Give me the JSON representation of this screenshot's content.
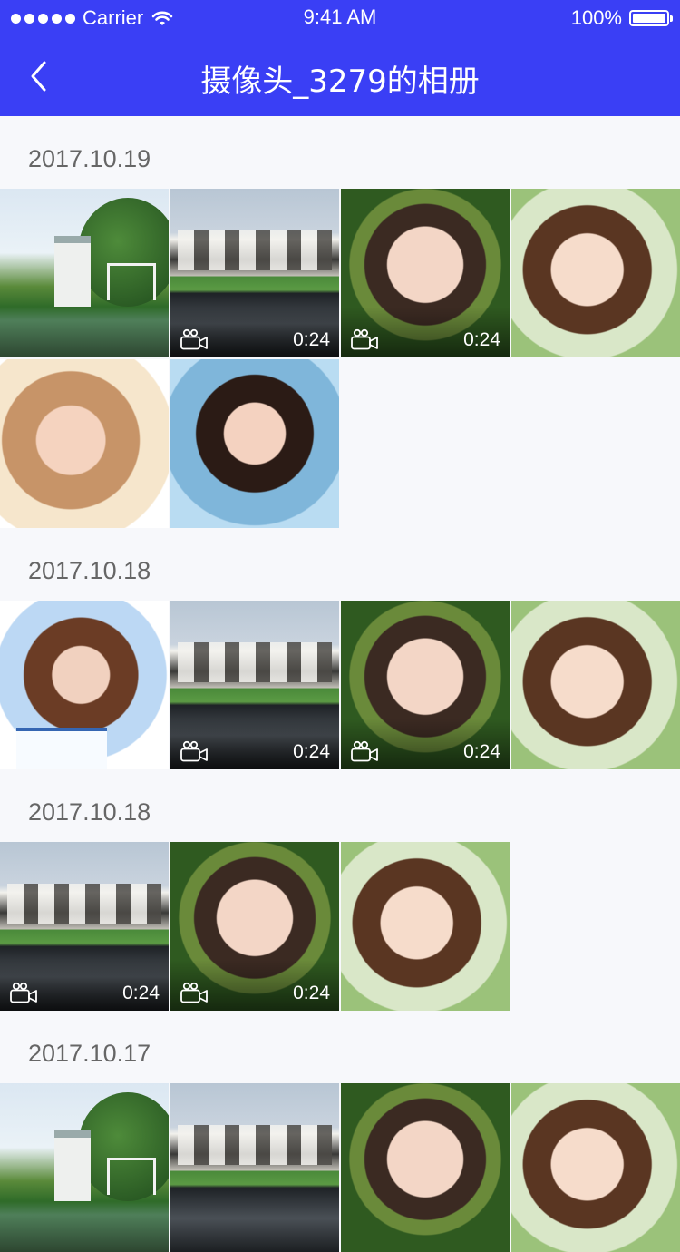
{
  "status_bar": {
    "carrier": "Carrier",
    "time": "9:41 AM",
    "battery": "100%"
  },
  "header": {
    "title": "摄像头_3279的相册"
  },
  "sections": [
    {
      "date": "2017.10.19",
      "items": [
        {
          "kind": "villa"
        },
        {
          "kind": "modern",
          "duration": "0:24"
        },
        {
          "kind": "girl",
          "duration": "0:24"
        },
        {
          "kind": "girl2"
        },
        {
          "kind": "blonde"
        },
        {
          "kind": "smile"
        }
      ]
    },
    {
      "date": "2017.10.18",
      "items": [
        {
          "kind": "sailor"
        },
        {
          "kind": "modern",
          "duration": "0:24"
        },
        {
          "kind": "girl",
          "duration": "0:24"
        },
        {
          "kind": "girl2"
        }
      ]
    },
    {
      "date": "2017.10.18",
      "items": [
        {
          "kind": "modern",
          "duration": "0:24"
        },
        {
          "kind": "girl",
          "duration": "0:24"
        },
        {
          "kind": "girl2"
        }
      ]
    },
    {
      "date": "2017.10.17",
      "items": [
        {
          "kind": "villa"
        },
        {
          "kind": "modern"
        },
        {
          "kind": "girl"
        },
        {
          "kind": "girl2"
        }
      ]
    }
  ],
  "colors": {
    "header_bg": "#3a3ff5",
    "page_bg": "#f7f8fb",
    "date_text": "#666666"
  },
  "icons": {
    "back": "chevron-left-icon",
    "video": "video-camera-icon",
    "signal": "signal-dots-icon",
    "wifi": "wifi-icon",
    "battery": "battery-icon"
  }
}
